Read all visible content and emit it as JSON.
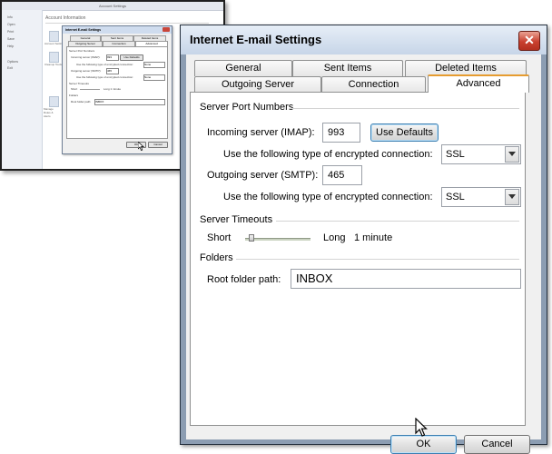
{
  "background": {
    "window_title": "Account Settings",
    "heading": "Account Information",
    "nav_items": [
      "Info",
      "Open",
      "Print",
      "Save",
      "Help",
      "Options",
      "Exit"
    ],
    "icon_captions": [
      "Account Settings",
      "Cleanup Tools",
      "Manage Rules & Alerts"
    ],
    "mini_dialog": {
      "title": "Internet E-mail Settings",
      "tabs_row1": [
        "General",
        "Sent Items",
        "Deleted Items"
      ],
      "tabs_row2": [
        "Outgoing Server",
        "Connection",
        "Advanced"
      ],
      "section_ports": "Server Port Numbers",
      "incoming_label": "Incoming server (IMAP):",
      "incoming_value": "993",
      "use_defaults": "Use Defaults",
      "enc_label": "Use the following type of encrypted connection:",
      "enc_value": "None",
      "outgoing_label": "Outgoing server (SMTP):",
      "outgoing_value": "465",
      "section_timeouts": "Server Timeouts",
      "short": "Short",
      "long": "Long 1 minute",
      "section_folders": "Folders",
      "root_label": "Root folder path:",
      "root_value": "INBOX",
      "ok": "OK",
      "cancel": "Cancel"
    }
  },
  "dialog": {
    "title": "Internet E-mail Settings",
    "close_glyph": "✕",
    "tabs_row1": [
      "General",
      "Sent Items",
      "Deleted Items"
    ],
    "tabs_row2": [
      "Outgoing Server",
      "Connection",
      "Advanced"
    ],
    "active_tab": "Advanced",
    "sections": {
      "ports": "Server Port Numbers",
      "timeouts": "Server Timeouts",
      "folders": "Folders"
    },
    "incoming_label": "Incoming server (IMAP):",
    "incoming_value": "993",
    "use_defaults_label": "Use Defaults",
    "incoming_enc_label": "Use the following type of encrypted connection:",
    "incoming_enc_value": "SSL",
    "outgoing_label": "Outgoing server (SMTP):",
    "outgoing_value": "465",
    "outgoing_enc_label": "Use the following type of encrypted connection:",
    "outgoing_enc_value": "SSL",
    "timeout_short": "Short",
    "timeout_long": "Long",
    "timeout_value": "1 minute",
    "timeout_fraction": 0.05,
    "root_folder_label": "Root folder path:",
    "root_folder_value": "INBOX",
    "ok_label": "OK",
    "cancel_label": "Cancel"
  },
  "icons": {
    "close": "close-icon",
    "dropdown": "chevron-down-icon",
    "cursor": "mouse-pointer-icon"
  },
  "colors": {
    "active_tab_accent": "#e69c30",
    "close_button": "#c9402f",
    "focus_border": "#3c7fb1"
  }
}
